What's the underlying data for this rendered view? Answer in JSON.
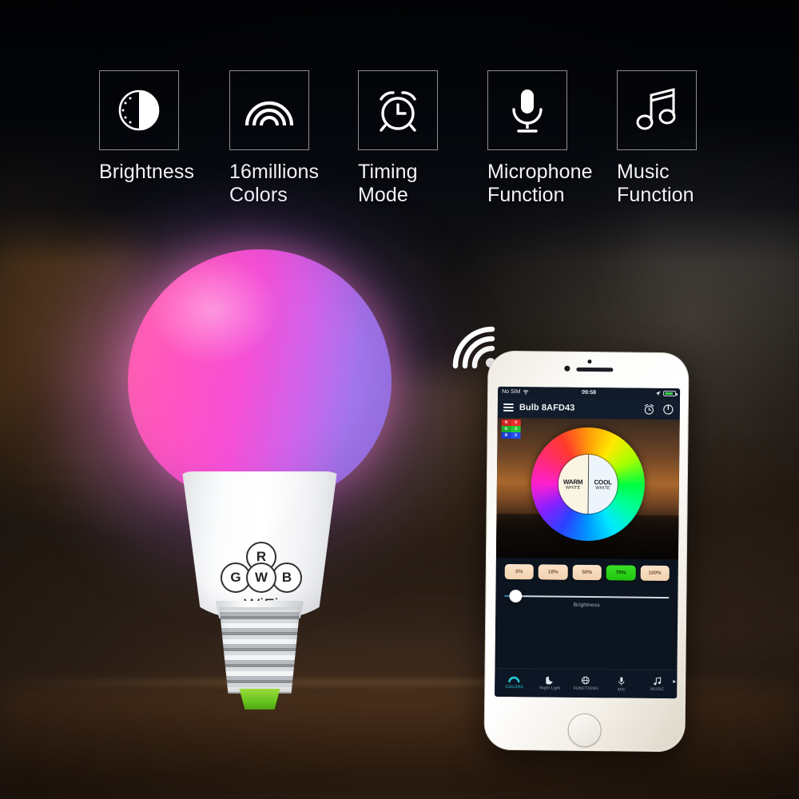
{
  "features": [
    {
      "icon": "brightness-icon",
      "label": "Brightness"
    },
    {
      "icon": "rainbow-icon",
      "label": "16millions\nColors"
    },
    {
      "icon": "alarm-clock-icon",
      "label": "Timing\nMode"
    },
    {
      "icon": "microphone-icon",
      "label": "Microphone\nFunction"
    },
    {
      "icon": "music-note-icon",
      "label": "Music\nFunction"
    }
  ],
  "bulb": {
    "badge_letters": {
      "r": "R",
      "g": "G",
      "w": "W",
      "b": "B"
    },
    "wifi_text": "WiFi",
    "globe_color_left": "#ff63ad",
    "globe_color_right": "#9a7ff0",
    "tip_color": "#63c31d"
  },
  "phone": {
    "status_bar": {
      "carrier": "No SIM",
      "wifi_icon": "wifi-icon",
      "time": "09:58",
      "location_icon": "location-arrow-icon",
      "battery_icon": "battery-icon"
    },
    "app": {
      "menu_icon": "hamburger-menu-icon",
      "title": "Bulb 8AFD43",
      "alarm_icon": "alarm-clock-icon",
      "power_icon": "power-icon",
      "rgb_chips": [
        {
          "label": "R",
          "color": "#ef2b2b"
        },
        {
          "label": "G",
          "color": "#27c935"
        },
        {
          "label": "B",
          "color": "#2450ef"
        }
      ],
      "color_wheel": {
        "warm_line1": "WARM",
        "warm_line2": "WHITE",
        "cool_line1": "COOL",
        "cool_line2": "WHITE"
      },
      "presets": [
        {
          "label": "0%",
          "active": false
        },
        {
          "label": "18%",
          "active": false
        },
        {
          "label": "50%",
          "active": false
        },
        {
          "label": "75%",
          "active": true
        },
        {
          "label": "100%",
          "active": false
        }
      ],
      "brightness": {
        "label": "Brightness",
        "value": 5
      },
      "tabs": [
        {
          "label": "COLORS",
          "icon": "color-arc-icon",
          "active": true
        },
        {
          "label": "Night Light",
          "icon": "moon-icon",
          "active": false
        },
        {
          "label": "FUNCTIONS",
          "icon": "globe-icon",
          "active": false
        },
        {
          "label": "MIC",
          "icon": "microphone-icon",
          "active": false
        },
        {
          "label": "MUSIC",
          "icon": "music-note-icon",
          "active": false
        }
      ],
      "more_arrow": "▸"
    }
  }
}
